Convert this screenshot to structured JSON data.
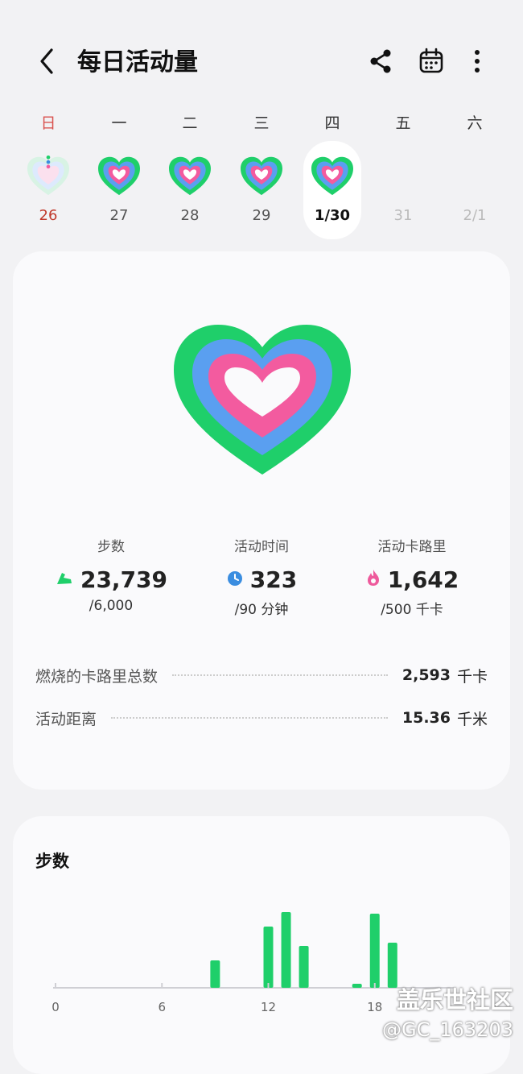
{
  "header": {
    "title": "每日活动量",
    "icons": [
      "back-chevron-icon",
      "share-icon",
      "calendar-icon",
      "more-vertical-icon"
    ]
  },
  "week": {
    "weekdays": [
      "日",
      "一",
      "二",
      "三",
      "四",
      "五",
      "六"
    ],
    "days": [
      {
        "label": "26",
        "state": "past-low"
      },
      {
        "label": "27",
        "state": "past"
      },
      {
        "label": "28",
        "state": "past"
      },
      {
        "label": "29",
        "state": "past"
      },
      {
        "label": "1/30",
        "state": "selected"
      },
      {
        "label": "31",
        "state": "future"
      },
      {
        "label": "2/1",
        "state": "future"
      }
    ]
  },
  "summary": {
    "metrics": [
      {
        "label": "步数",
        "value": "23,739",
        "goal": "/6,000",
        "icon": "shoe-icon",
        "color": "#2ecc71"
      },
      {
        "label": "活动时间",
        "value": "323",
        "goal": "/90 分钟",
        "icon": "clock-icon",
        "color": "#3a8de0"
      },
      {
        "label": "活动卡路里",
        "value": "1,642",
        "goal": "/500 千卡",
        "icon": "flame-icon",
        "color": "#ee5a9c"
      }
    ],
    "rows": [
      {
        "label": "燃烧的卡路里总数",
        "value": "2,593",
        "unit": "千卡"
      },
      {
        "label": "活动距离",
        "value": "15.36",
        "unit": "千米"
      }
    ],
    "colors": {
      "steps_ring": "#1fcf6a",
      "time_ring": "#5a9ff0",
      "calorie_ring": "#f35b9f"
    }
  },
  "steps_card": {
    "title": "步数",
    "x_ticks": [
      "0",
      "6",
      "12",
      "18"
    ]
  },
  "chart_data": {
    "type": "bar",
    "title": "步数",
    "x": [
      9,
      12,
      13,
      14,
      17,
      18,
      19
    ],
    "values": [
      1700,
      3800,
      4700,
      2600,
      250,
      4600,
      2800
    ],
    "xlim": [
      0,
      24
    ],
    "ylim": [
      0,
      5000
    ],
    "x_ticks": [
      0,
      6,
      12,
      18
    ],
    "color": "#1fcf6a",
    "grid": false
  },
  "watermark": {
    "line1": "盖乐世社区",
    "line2": "@GC_163203"
  }
}
